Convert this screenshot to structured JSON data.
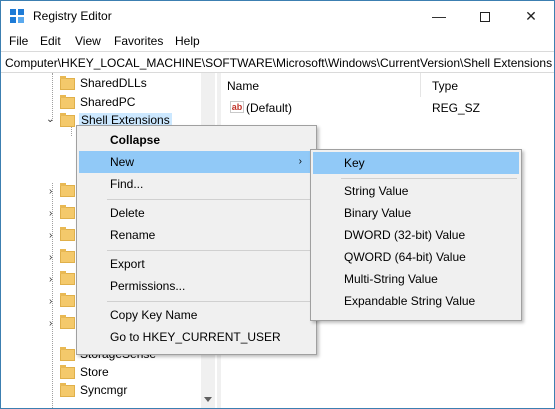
{
  "window": {
    "title": "Registry Editor",
    "icon": "registry-editor-icon",
    "controls": {
      "minimize": "—",
      "maximize": "",
      "close": "✕"
    }
  },
  "menubar": {
    "items": [
      {
        "label": "File"
      },
      {
        "label": "Edit"
      },
      {
        "label": "View"
      },
      {
        "label": "Favorites"
      },
      {
        "label": "Help"
      }
    ]
  },
  "address": {
    "path": "Computer\\HKEY_LOCAL_MACHINE\\SOFTWARE\\Microsoft\\Windows\\CurrentVersion\\Shell Extensions"
  },
  "tree": {
    "items": [
      {
        "label": "SharedDLLs"
      },
      {
        "label": "SharedPC"
      },
      {
        "label": "Shell Extensions",
        "selected": true,
        "expanded": true
      },
      {
        "label": "StorageSense"
      },
      {
        "label": "Store"
      },
      {
        "label": "Syncmgr"
      }
    ]
  },
  "listview": {
    "columns": {
      "name": "Name",
      "type": "Type"
    },
    "rows": [
      {
        "name": "(Default)",
        "type": "REG_SZ",
        "icon": "string-value-icon"
      }
    ]
  },
  "context_menu": {
    "items": [
      {
        "label": "Collapse",
        "bold": true
      },
      {
        "label": "New",
        "has_submenu": true,
        "highlighted": true
      },
      {
        "label": "Find..."
      },
      {
        "label": "Delete"
      },
      {
        "label": "Rename"
      },
      {
        "label": "Export"
      },
      {
        "label": "Permissions..."
      },
      {
        "label": "Copy Key Name"
      },
      {
        "label": "Go to HKEY_CURRENT_USER"
      }
    ],
    "submenu_arrow": "›"
  },
  "submenu": {
    "items": [
      {
        "label": "Key",
        "highlighted": true
      },
      {
        "label": "String Value"
      },
      {
        "label": "Binary Value"
      },
      {
        "label": "DWORD (32-bit) Value"
      },
      {
        "label": "QWORD (64-bit) Value"
      },
      {
        "label": "Multi-String Value"
      },
      {
        "label": "Expandable String Value"
      }
    ]
  },
  "colors": {
    "highlight": "#91c9f7",
    "selection": "#cce8ff",
    "folder": "#f4c96b",
    "menu_bg": "#f0f0f0"
  }
}
